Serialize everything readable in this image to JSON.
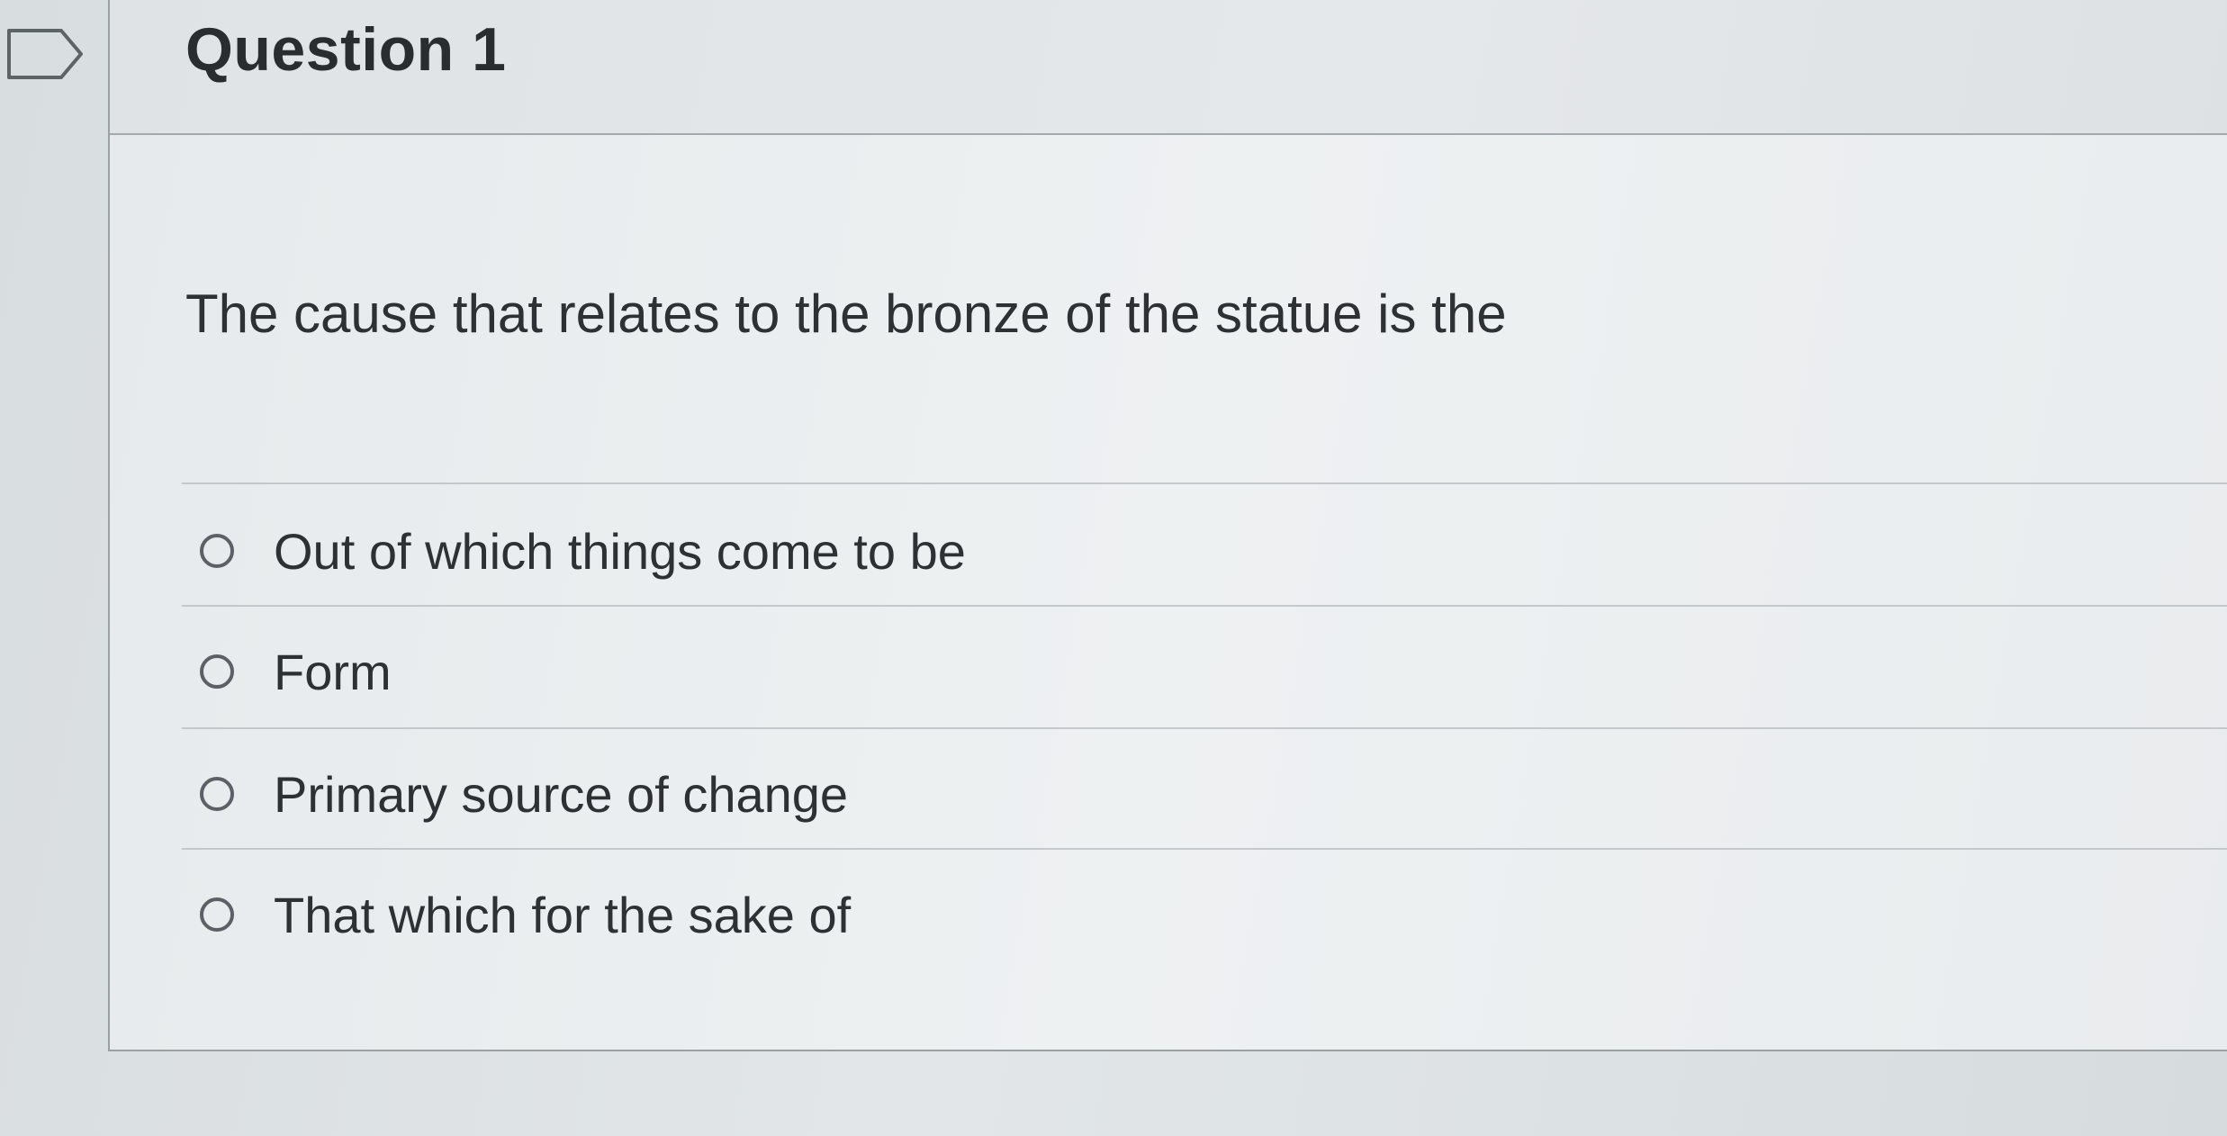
{
  "question": {
    "title": "Question 1",
    "prompt": "The cause that relates to the bronze of the statue is the",
    "flag_icon": "bookmark-flag-icon"
  },
  "answers": [
    {
      "label": "Out of which things come to be",
      "selected": false
    },
    {
      "label": "Form",
      "selected": false
    },
    {
      "label": "Primary source of change",
      "selected": false
    },
    {
      "label": "That which for the sake of",
      "selected": false
    }
  ],
  "colors": {
    "background": "#dadfe0",
    "text": "#2e3134",
    "border": "#9aa1a5"
  }
}
